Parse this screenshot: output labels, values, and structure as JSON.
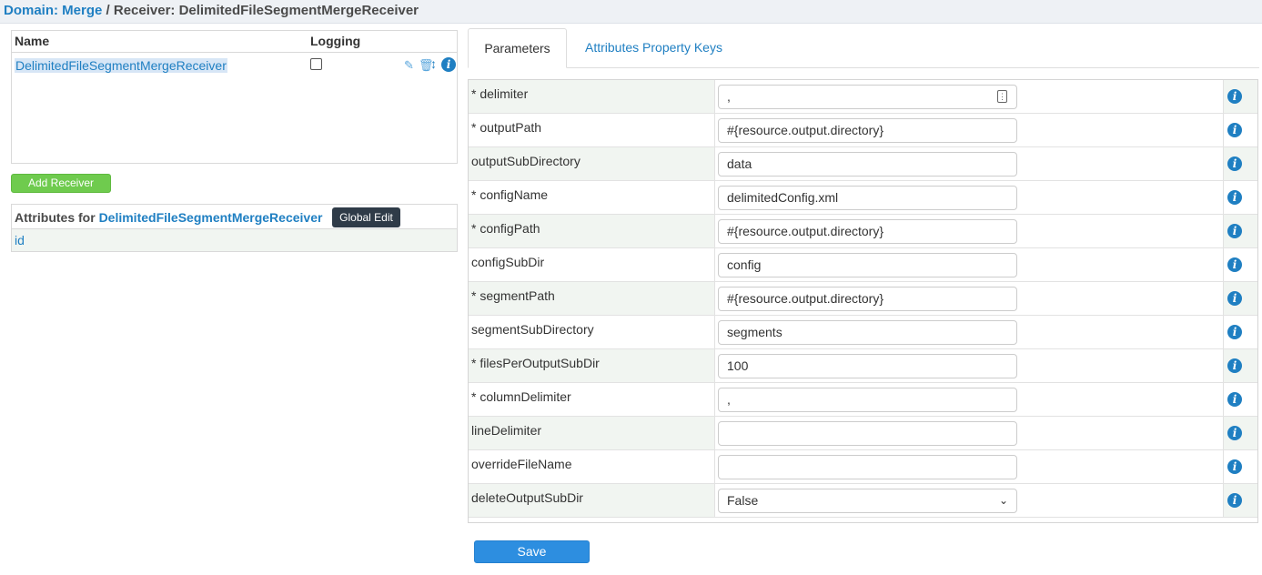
{
  "breadcrumb": {
    "domain_label": "Domain:",
    "domain_value": "Merge",
    "separator": "/",
    "receiver_prefix": "Receiver:",
    "receiver_name": "DelimitedFileSegmentMergeReceiver"
  },
  "receivers": {
    "columns": {
      "name": "Name",
      "logging": "Logging"
    },
    "rows": [
      {
        "name": "DelimitedFileSegmentMergeReceiver",
        "logging": false
      }
    ],
    "icons": [
      "pencil-icon",
      "trash-icon",
      "move-icon",
      "info-icon"
    ],
    "add_button": "Add Receiver"
  },
  "attributes": {
    "title_prefix": "Attributes for",
    "receiver_name": "DelimitedFileSegmentMergeReceiver",
    "global_edit": "Global Edit",
    "items": [
      "id"
    ]
  },
  "tabs": [
    {
      "label": "Parameters",
      "active": true
    },
    {
      "label": "Attributes Property Keys",
      "active": false
    }
  ],
  "parameters": [
    {
      "label": "* delimiter",
      "value": ",",
      "kind": "text-with-icon"
    },
    {
      "label": "* outputPath",
      "value": "#{resource.output.directory}",
      "kind": "text"
    },
    {
      "label": "outputSubDirectory",
      "value": "data",
      "kind": "text"
    },
    {
      "label": "* configName",
      "value": "delimitedConfig.xml",
      "kind": "text"
    },
    {
      "label": "* configPath",
      "value": "#{resource.output.directory}",
      "kind": "text"
    },
    {
      "label": "configSubDir",
      "value": "config",
      "kind": "text"
    },
    {
      "label": "* segmentPath",
      "value": "#{resource.output.directory}",
      "kind": "text"
    },
    {
      "label": "segmentSubDirectory",
      "value": "segments",
      "kind": "text"
    },
    {
      "label": "* filesPerOutputSubDir",
      "value": "100",
      "kind": "text"
    },
    {
      "label": "* columnDelimiter",
      "value": ",",
      "kind": "text"
    },
    {
      "label": "lineDelimiter",
      "value": "",
      "kind": "text"
    },
    {
      "label": "overrideFileName",
      "value": "",
      "kind": "text"
    },
    {
      "label": "deleteOutputSubDir",
      "value": "False",
      "kind": "select"
    }
  ],
  "save_button": "Save",
  "colors": {
    "accent": "#1f7fc2",
    "add_green": "#6fcb4e",
    "save_blue": "#2d8ee0",
    "row_alt": "#f1f5f1"
  }
}
